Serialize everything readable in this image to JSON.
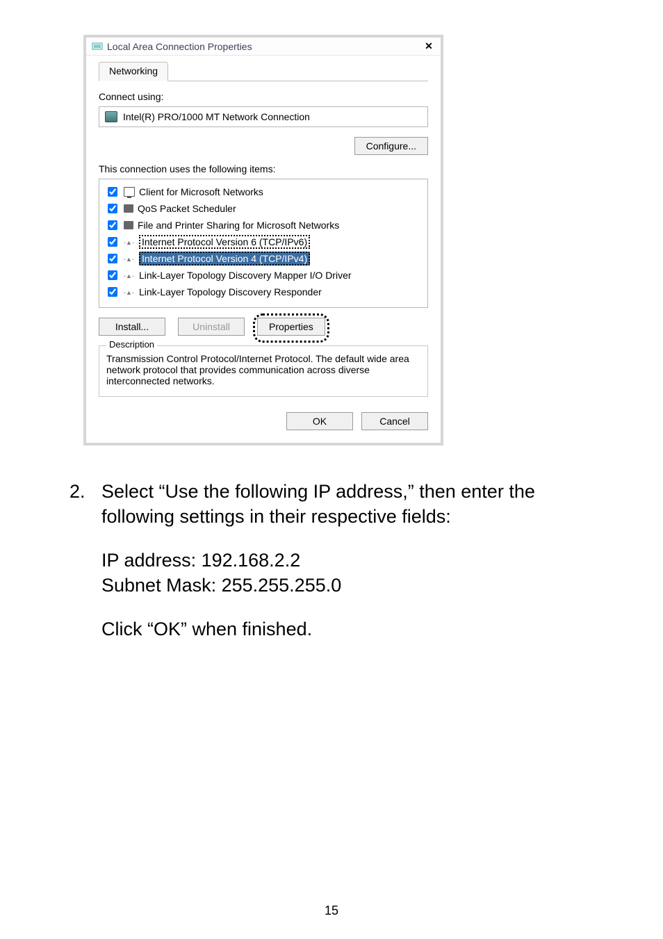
{
  "dialog": {
    "title": "Local Area Connection Properties",
    "close_glyph": "✕",
    "tab_networking": "Networking",
    "connect_using_label": "Connect using:",
    "adapter_name": "Intel(R) PRO/1000 MT Network Connection",
    "configure_btn": "Configure...",
    "items_label": "This connection uses the following items:",
    "items": [
      "Client for Microsoft Networks",
      "QoS Packet Scheduler",
      "File and Printer Sharing for Microsoft Networks",
      "Internet Protocol Version 6 (TCP/IPv6)",
      "Internet Protocol Version 4 (TCP/IPv4)",
      "Link-Layer Topology Discovery Mapper I/O Driver",
      "Link-Layer Topology Discovery Responder"
    ],
    "install_btn": "Install...",
    "uninstall_btn": "Uninstall",
    "properties_btn": "Properties",
    "desc_legend": "Description",
    "desc_text": "Transmission Control Protocol/Internet Protocol. The default wide area network protocol that provides communication across diverse interconnected networks.",
    "ok_btn": "OK",
    "cancel_btn": "Cancel"
  },
  "instructions": {
    "step_number": "2.",
    "step_text": "Select “Use the following IP address,” then enter the following settings in their respective fields:",
    "ip_line": "IP address: 192.168.2.2",
    "mask_line": "Subnet Mask: 255.255.255.0",
    "click_ok": "Click “OK” when finished."
  },
  "page_number": "15"
}
